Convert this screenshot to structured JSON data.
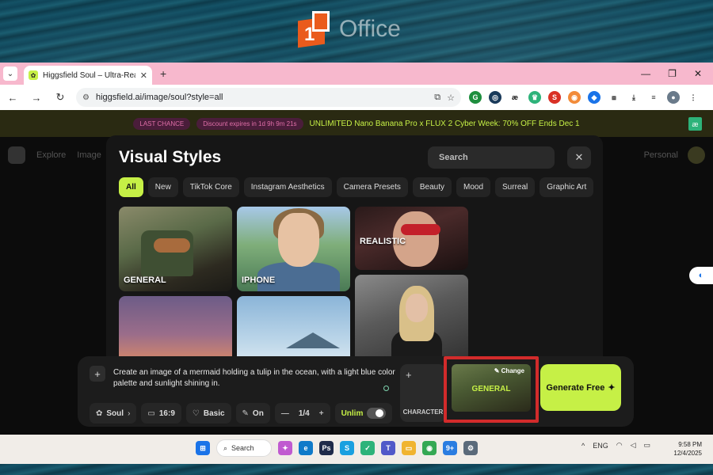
{
  "desktop": {
    "logo_text": "Office"
  },
  "browser": {
    "tab_title": "Higgsfield Soul – Ultra-Realistic",
    "url": "higgsfield.ai/image/soul?style=all"
  },
  "site": {
    "banner": {
      "pill1": "LAST CHANCE",
      "pill2": "Discount expires in 1d 9h 9m 21s",
      "text": "UNLIMITED Nano Banana Pro x FLUX 2 Cyber Week: 70% OFF Ends Dec 1"
    },
    "nav": {
      "explore": "Explore",
      "image": "Image",
      "personal": "Personal"
    }
  },
  "modal": {
    "title": "Visual Styles",
    "search_placeholder": "Search",
    "chips": [
      "All",
      "New",
      "TikTok Core",
      "Instagram Aesthetics",
      "Camera Presets",
      "Beauty",
      "Mood",
      "Surreal",
      "Graphic Art"
    ],
    "cards": {
      "general": "GENERAL",
      "iphone": "IPHONE",
      "realistic": "REALISTIC"
    }
  },
  "prompt": {
    "text": "Create an image of a mermaid holding a tulip in the ocean, with a light blue color palette and sunlight shining in.",
    "model": "Soul",
    "aspect": "16:9",
    "quality": "Basic",
    "enhance": "On",
    "count": "1/4",
    "unlim": "Unlim",
    "character_label": "CHARACTER",
    "style_change": "Change",
    "style_name": "GENERAL",
    "generate_label": "Generate Free"
  },
  "taskbar": {
    "search_label": "Search",
    "lang": "ENG",
    "time": "9:58 PM",
    "date": "12/4/2025",
    "edge_badge": "9+"
  },
  "colors": {
    "accent": "#c6f046",
    "highlight_box": "#d22b2b",
    "tabbar": "#f7b8cd"
  }
}
